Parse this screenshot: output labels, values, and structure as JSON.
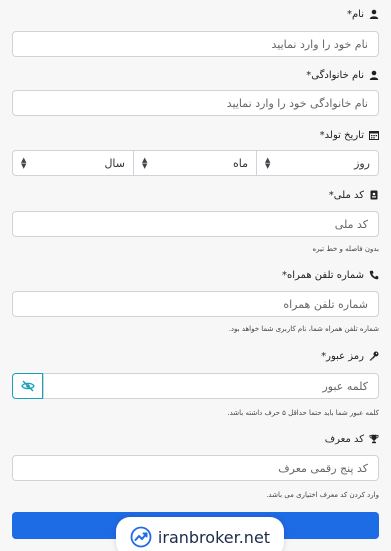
{
  "form": {
    "first_name": {
      "label": "نام*",
      "icon": "user-icon",
      "placeholder": "نام خود را وارد نمایید"
    },
    "last_name": {
      "label": "نام خانوادگی*",
      "icon": "user-icon",
      "placeholder": "نام خانوادگی خود را وارد نمایید"
    },
    "birth_date": {
      "label": "تاریخ تولد*",
      "icon": "calendar-icon",
      "day": "روز",
      "month": "ماه",
      "year": "سال"
    },
    "national_code": {
      "label": "کد ملی*",
      "icon": "id-card-icon",
      "placeholder": "کد ملی",
      "hint": "بدون فاصله و خط تیره"
    },
    "mobile": {
      "label": "شماره تلفن همراه*",
      "icon": "phone-icon",
      "placeholder": "شماره تلفن همراه",
      "hint": "شماره تلفن همراه شما، نام کاربری شما خواهد بود."
    },
    "password": {
      "label": "رمز عبور*",
      "icon": "key-icon",
      "placeholder": "کلمه عبور",
      "hint": "کلمه عبور شما باید حتما حداقل ۵ حرف داشته باشد."
    },
    "referral": {
      "label": "کد معرف",
      "icon": "trophy-icon",
      "placeholder": "کد پنج رقمی معرف",
      "hint": "وارد کردن کد معرف اختیاری می باشد."
    }
  },
  "brand": {
    "name": "iranbroker.net"
  },
  "colors": {
    "accent": "#1e6be6",
    "eye_border": "#17a2b8",
    "background": "#f7f7f7"
  }
}
